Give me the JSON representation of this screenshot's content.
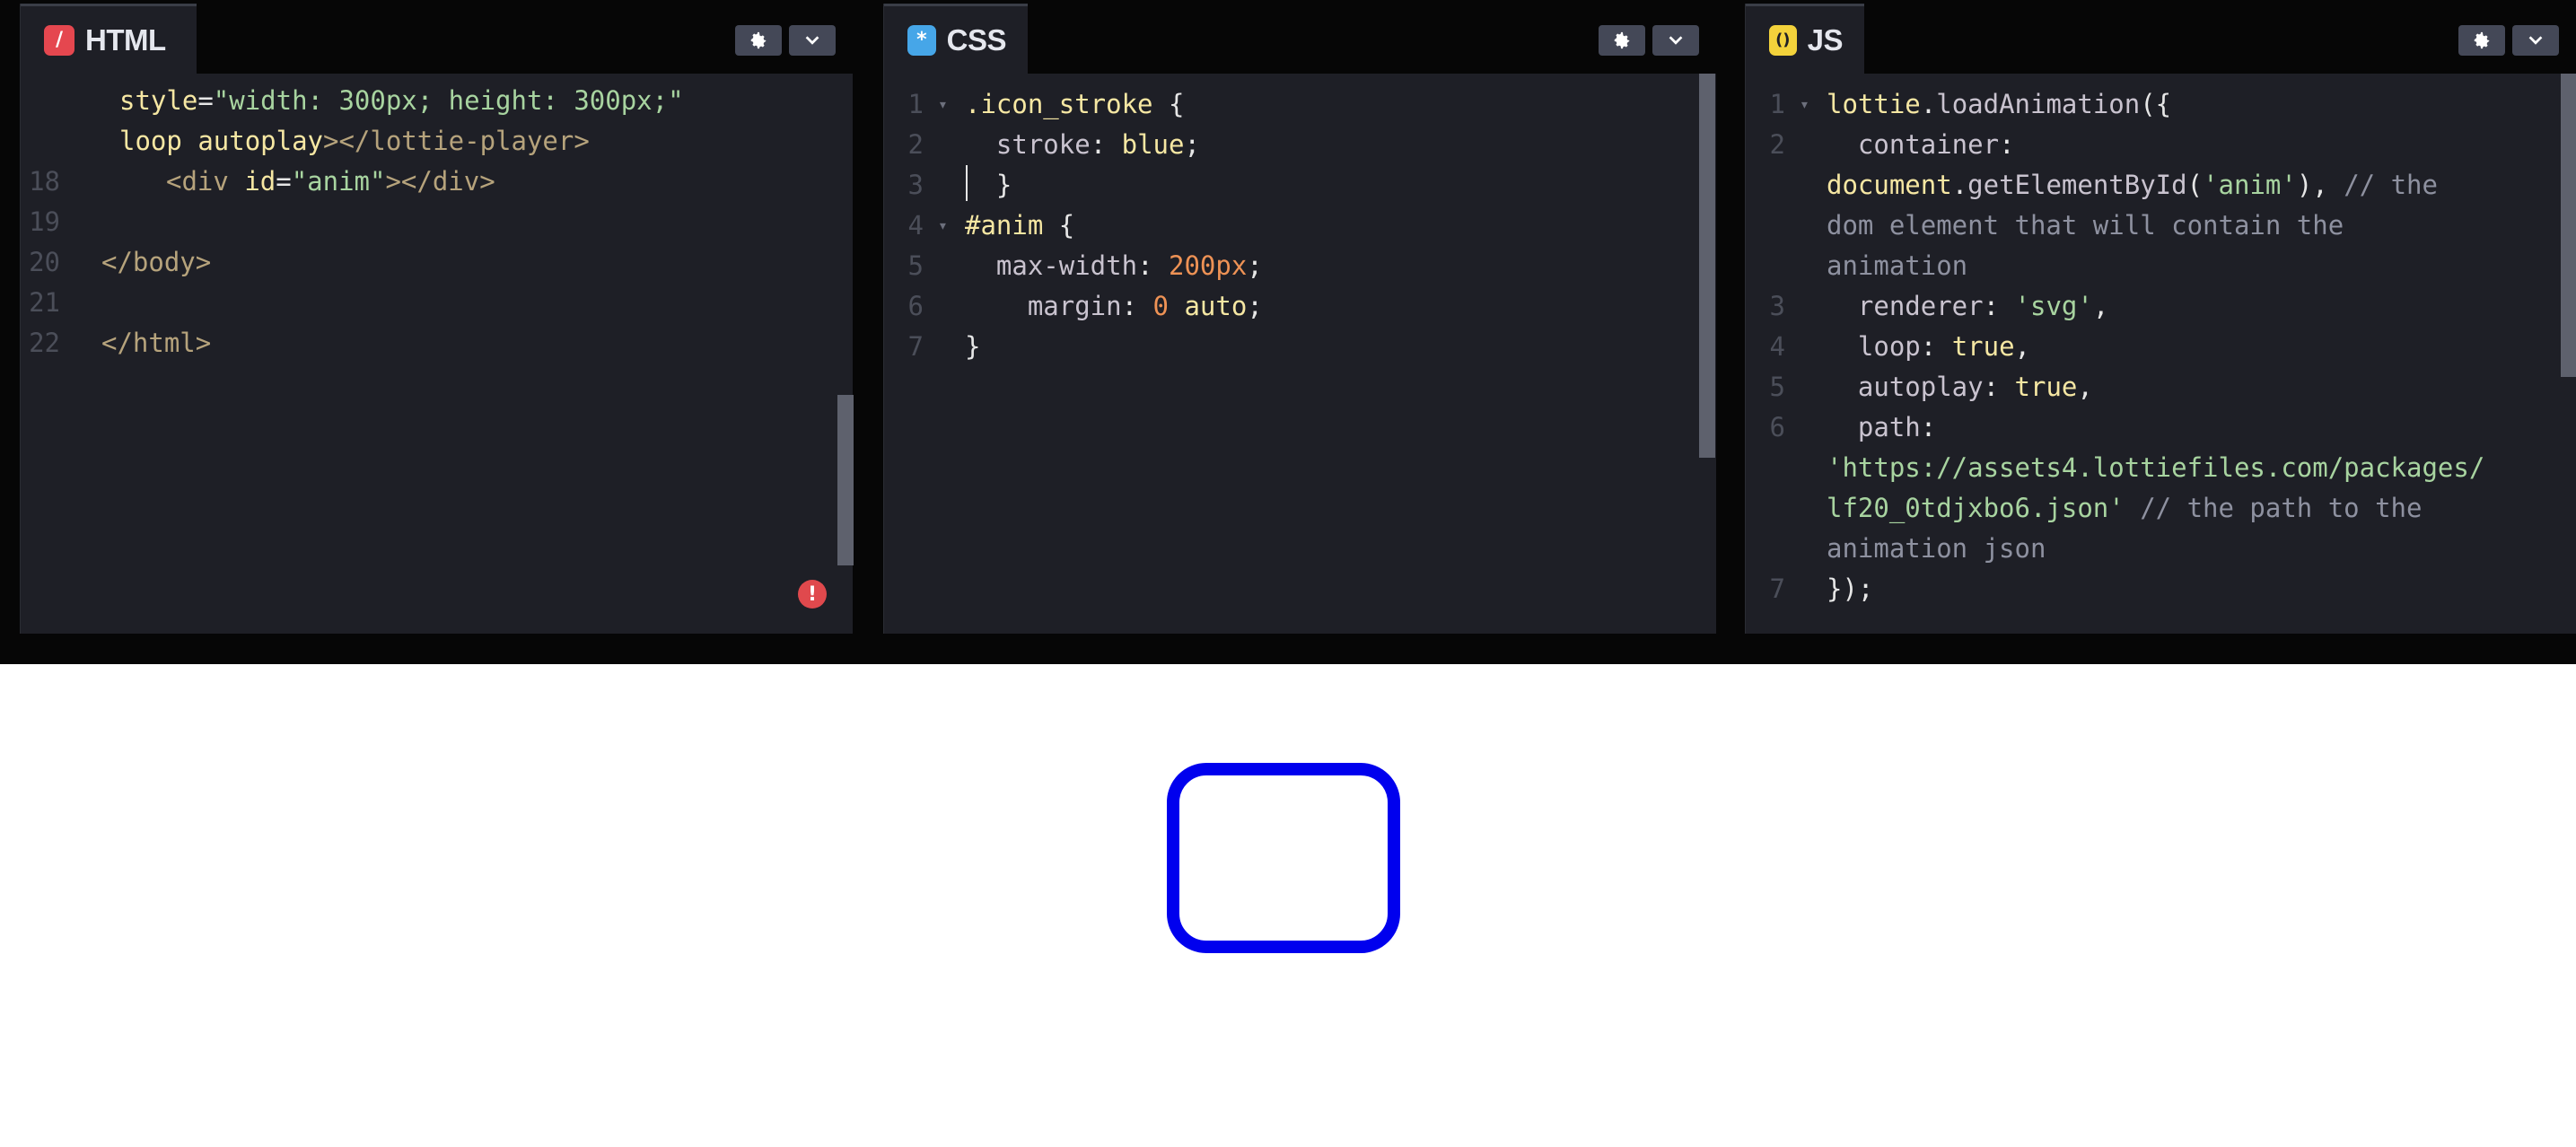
{
  "colors": {
    "html_icon": "#e5474f",
    "css_icon": "#46a6e8",
    "js_icon": "#f3d23b",
    "shape_stroke": "#0000ee",
    "error_badge": "#e0494d"
  },
  "panels": {
    "html": {
      "tab_label": "HTML",
      "icon_glyph": "/",
      "lines": [
        {
          "n": "",
          "parts": [
            {
              "t": "style",
              "c": "c-attr"
            },
            {
              "t": "=",
              "c": "c-punc"
            },
            {
              "t": "\"width: 300px; height: 300px;\"",
              "c": "c-str"
            }
          ]
        },
        {
          "n": "",
          "parts": [
            {
              "t": "loop ",
              "c": "c-attr"
            },
            {
              "t": "autoplay",
              "c": "c-attr"
            },
            {
              "t": "></lottie-player>",
              "c": "c-tag"
            }
          ]
        },
        {
          "n": "18",
          "parts": [
            {
              "t": "<div ",
              "c": "c-tag"
            },
            {
              "t": "id",
              "c": "c-attr"
            },
            {
              "t": "=",
              "c": "c-punc"
            },
            {
              "t": "\"anim\"",
              "c": "c-str"
            },
            {
              "t": "></div>",
              "c": "c-tag"
            }
          ]
        },
        {
          "n": "19",
          "parts": []
        },
        {
          "n": "20",
          "parts": [
            {
              "t": "</body>",
              "c": "c-tag"
            }
          ]
        },
        {
          "n": "21",
          "parts": []
        },
        {
          "n": "22",
          "parts": [
            {
              "t": "</html>",
              "c": "c-tag"
            }
          ]
        }
      ],
      "error_glyph": "!"
    },
    "css": {
      "tab_label": "CSS",
      "icon_glyph": "*",
      "lines": [
        {
          "n": "1",
          "fold": true,
          "parts": [
            {
              "t": ".icon_stroke",
              "c": "c-sel"
            },
            {
              "t": " {",
              "c": "c-punc"
            }
          ]
        },
        {
          "n": "2",
          "parts": [
            {
              "t": "  stroke",
              "c": "c-prop"
            },
            {
              "t": ": ",
              "c": "c-punc"
            },
            {
              "t": "blue",
              "c": "c-val"
            },
            {
              "t": ";",
              "c": "c-punc"
            }
          ]
        },
        {
          "n": "3",
          "parts": [
            {
              "t": "  }",
              "c": "c-punc"
            }
          ]
        },
        {
          "n": "4",
          "fold": true,
          "parts": [
            {
              "t": "#anim",
              "c": "c-sel"
            },
            {
              "t": " {",
              "c": "c-punc"
            }
          ]
        },
        {
          "n": "5",
          "parts": [
            {
              "t": "  max-width",
              "c": "c-prop"
            },
            {
              "t": ": ",
              "c": "c-punc"
            },
            {
              "t": "200px",
              "c": "c-num"
            },
            {
              "t": ";",
              "c": "c-punc"
            }
          ]
        },
        {
          "n": "6",
          "parts": [
            {
              "t": "    margin",
              "c": "c-prop"
            },
            {
              "t": ": ",
              "c": "c-punc"
            },
            {
              "t": "0",
              "c": "c-num"
            },
            {
              "t": " auto",
              "c": "c-val"
            },
            {
              "t": ";",
              "c": "c-punc"
            }
          ]
        },
        {
          "n": "7",
          "parts": [
            {
              "t": "}",
              "c": "c-punc"
            }
          ]
        }
      ]
    },
    "js": {
      "tab_label": "JS",
      "icon_glyph": "()",
      "lines": [
        {
          "n": "1",
          "fold": true,
          "parts": [
            {
              "t": "lottie",
              "c": "c-obj"
            },
            {
              "t": ".",
              "c": "c-punc"
            },
            {
              "t": "loadAnimation",
              "c": "c-fn"
            },
            {
              "t": "({",
              "c": "c-punc"
            }
          ]
        },
        {
          "n": "2",
          "parts": [
            {
              "t": "  container",
              "c": "c-prop"
            },
            {
              "t": ":",
              "c": "c-punc"
            }
          ]
        },
        {
          "n": "",
          "parts": [
            {
              "t": "document",
              "c": "c-obj"
            },
            {
              "t": ".",
              "c": "c-punc"
            },
            {
              "t": "getElementById",
              "c": "c-fn"
            },
            {
              "t": "(",
              "c": "c-punc"
            },
            {
              "t": "'anim'",
              "c": "c-str"
            },
            {
              "t": "), ",
              "c": "c-punc"
            },
            {
              "t": "// the",
              "c": "c-cmt"
            }
          ]
        },
        {
          "n": "",
          "parts": [
            {
              "t": "dom element that will contain the",
              "c": "c-cmt"
            }
          ]
        },
        {
          "n": "",
          "parts": [
            {
              "t": "animation",
              "c": "c-cmt"
            }
          ]
        },
        {
          "n": "3",
          "parts": [
            {
              "t": "  renderer",
              "c": "c-prop"
            },
            {
              "t": ": ",
              "c": "c-punc"
            },
            {
              "t": "'svg'",
              "c": "c-str"
            },
            {
              "t": ",",
              "c": "c-punc"
            }
          ]
        },
        {
          "n": "4",
          "parts": [
            {
              "t": "  loop",
              "c": "c-prop"
            },
            {
              "t": ": ",
              "c": "c-punc"
            },
            {
              "t": "true",
              "c": "c-bool"
            },
            {
              "t": ",",
              "c": "c-punc"
            }
          ]
        },
        {
          "n": "5",
          "parts": [
            {
              "t": "  autoplay",
              "c": "c-prop"
            },
            {
              "t": ": ",
              "c": "c-punc"
            },
            {
              "t": "true",
              "c": "c-bool"
            },
            {
              "t": ",",
              "c": "c-punc"
            }
          ]
        },
        {
          "n": "6",
          "parts": [
            {
              "t": "  path",
              "c": "c-prop"
            },
            {
              "t": ":",
              "c": "c-punc"
            }
          ]
        },
        {
          "n": "",
          "parts": [
            {
              "t": "'https://assets4.lottiefiles.com/packages/",
              "c": "c-str"
            }
          ]
        },
        {
          "n": "",
          "parts": [
            {
              "t": "lf20_0tdjxbo6.json'",
              "c": "c-str"
            },
            {
              "t": " // the path to the",
              "c": "c-cmt"
            }
          ]
        },
        {
          "n": "",
          "parts": [
            {
              "t": "animation json",
              "c": "c-cmt"
            }
          ]
        },
        {
          "n": "7",
          "parts": [
            {
              "t": "});",
              "c": "c-punc"
            }
          ]
        }
      ]
    }
  }
}
